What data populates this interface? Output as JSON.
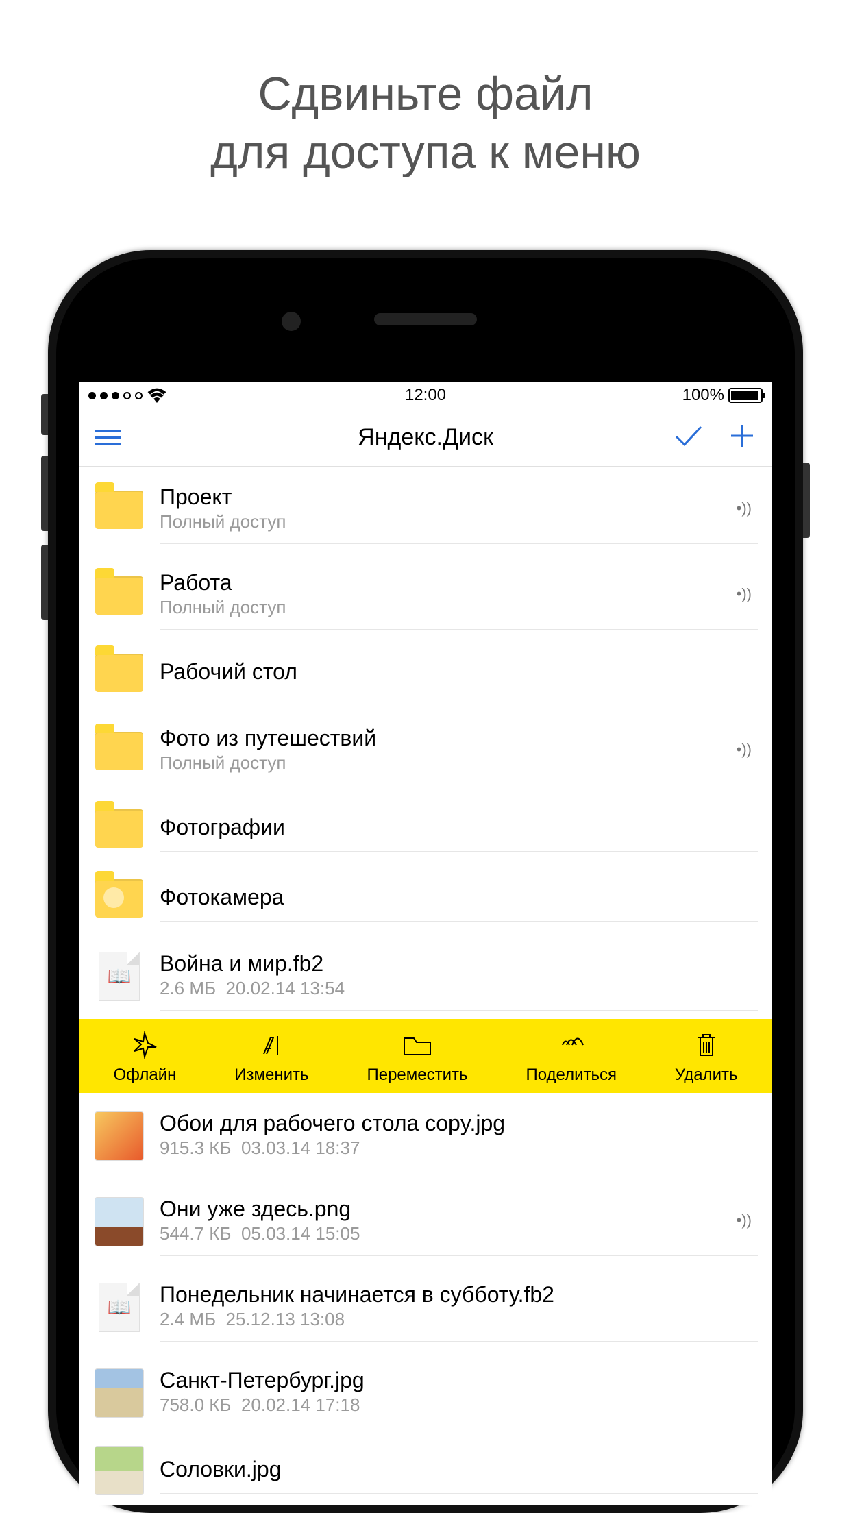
{
  "promo": {
    "line1": "Сдвиньте файл",
    "line2": "для доступа к меню"
  },
  "statusbar": {
    "time": "12:00",
    "battery": "100%"
  },
  "navbar": {
    "title": "Яндекс.Диск"
  },
  "access_label": "Полный доступ",
  "items": [
    {
      "kind": "folder",
      "name": "Проект",
      "access": true,
      "shared": true
    },
    {
      "kind": "folder",
      "name": "Работа",
      "access": true,
      "shared": true
    },
    {
      "kind": "folder",
      "name": "Рабочий стол",
      "access": false,
      "shared": false
    },
    {
      "kind": "folder",
      "name": "Фото из путешествий",
      "access": true,
      "shared": true
    },
    {
      "kind": "folder",
      "name": "Фотографии",
      "access": false,
      "shared": false
    },
    {
      "kind": "folder-cam",
      "name": "Фотокамера",
      "access": false,
      "shared": false
    },
    {
      "kind": "book",
      "name": "Война и мир.fb2",
      "meta": "2.6 МБ  20.02.14 13:54",
      "shared": false
    },
    {
      "kind": "img",
      "variant": "fire",
      "name": "Обои для рабочего стола copy.jpg",
      "meta": "915.3 КБ  03.03.14 18:37",
      "shared": false
    },
    {
      "kind": "img",
      "variant": "ufo",
      "name": "Они уже здесь.png",
      "meta": "544.7 КБ  05.03.14 15:05",
      "shared": true
    },
    {
      "kind": "book",
      "name": "Понедельник начинается в субботу.fb2",
      "meta": "2.4 МБ  25.12.13 13:08",
      "shared": false
    },
    {
      "kind": "img",
      "variant": "spb",
      "name": "Санкт-Петербург.jpg",
      "meta": "758.0 КБ  20.02.14 17:18",
      "shared": false
    },
    {
      "kind": "img",
      "variant": "slv",
      "name": "Соловки.jpg",
      "meta": "",
      "shared": false
    }
  ],
  "actionbar": {
    "offline": "Офлайн",
    "rename": "Изменить",
    "move": "Переместить",
    "share": "Поделиться",
    "delete": "Удалить"
  },
  "actionbar_after_index": 6
}
